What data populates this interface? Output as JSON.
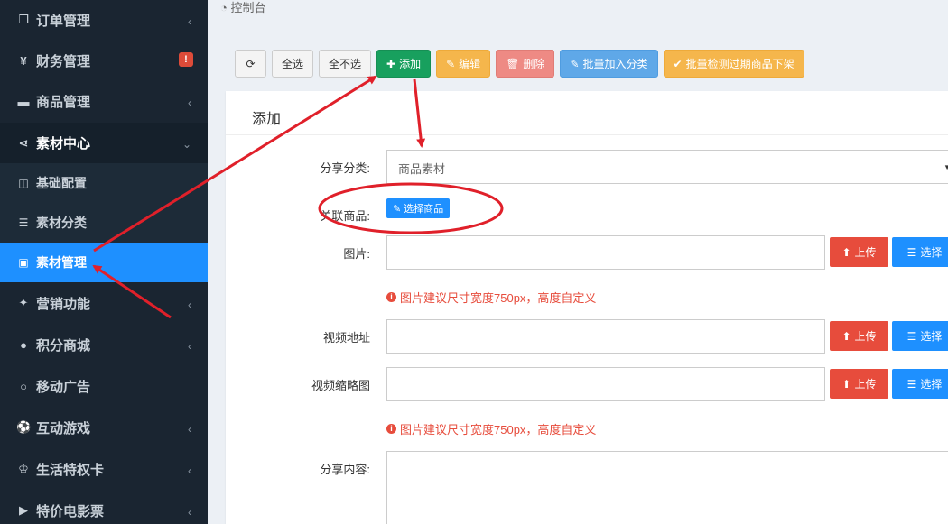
{
  "sidebar": {
    "items": [
      {
        "icon": "copy-icon",
        "glyph": "❐",
        "label": "订单管理"
      },
      {
        "icon": "yen-icon",
        "glyph": "¥",
        "label": "财务管理",
        "badge": "!"
      },
      {
        "icon": "briefcase-icon",
        "glyph": "▬",
        "label": "商品管理"
      },
      {
        "icon": "share-icon",
        "glyph": "⋖",
        "label": "素材中心"
      },
      {
        "icon": "gift-icon",
        "glyph": "✦",
        "label": "营销功能"
      },
      {
        "icon": "coin-icon",
        "glyph": "●",
        "label": "积分商城"
      },
      {
        "icon": "circle-icon",
        "glyph": "○",
        "label": "移动广告"
      },
      {
        "icon": "soccer-icon",
        "glyph": "⚽",
        "label": "互动游戏"
      },
      {
        "icon": "crown-icon",
        "glyph": "♔",
        "label": "生活特权卡"
      },
      {
        "icon": "video-icon",
        "glyph": "▶",
        "label": "特价电影票"
      }
    ],
    "submenu": [
      {
        "icon": "columns-icon",
        "glyph": "◫",
        "label": "基础配置"
      },
      {
        "icon": "list-icon",
        "glyph": "☰",
        "label": "素材分类"
      },
      {
        "icon": "image-icon",
        "glyph": "▣",
        "label": "素材管理"
      }
    ]
  },
  "breadcrumb": {
    "icon": "dashboard-icon",
    "label": "控制台"
  },
  "toolbar": {
    "refresh": "⟳",
    "select_all": "全选",
    "deselect_all": "全不选",
    "add": "添加",
    "edit": "编辑",
    "delete": "删除",
    "batch_category": "批量加入分类",
    "batch_check": "批量检测过期商品下架"
  },
  "form": {
    "title": "添加",
    "category_label": "分享分类:",
    "category_value": "商品素材",
    "product_label": "关联商品:",
    "product_button": "选择商品",
    "image_label": "图片:",
    "upload": "上传",
    "choose": "选择",
    "image_hint": "图片建议尺寸宽度750px，高度自定义",
    "video_url_label": "视频地址",
    "video_thumb_label": "视频缩略图",
    "video_thumb_hint": "图片建议尺寸宽度750px，高度自定义",
    "content_label": "分享内容:"
  },
  "colors": {
    "annotation": "#e0202a",
    "sidebar_bg": "#1a2531",
    "active": "#1e90ff"
  }
}
